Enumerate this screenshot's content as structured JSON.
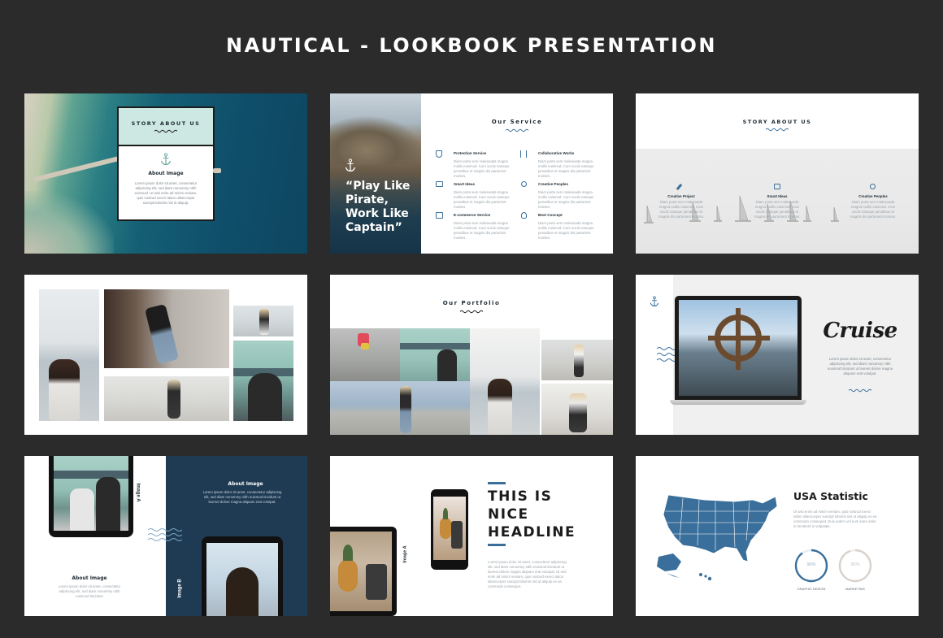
{
  "title": "NAUTICAL - LOOKBOOK PRESENTATION",
  "colors": {
    "background": "#2b2b2b",
    "navy": "#1f3b53",
    "accent_blue": "#3a6f9b",
    "mint": "#cde8e2"
  },
  "slide1": {
    "header": "STORY ABOUT US",
    "subheading": "About Image",
    "body": "Lorem ipsum dolor sit amet, consectetur adipiscing elit, sed diam nonummy nibh euismod. Ut wisi enim ad minim veniam, quis nostrud exerci tation ullamcorper suscipit lobortis nisl ut aliquip."
  },
  "slide2": {
    "quote": "“Play Like Pirate, Work Like Captain”",
    "header": "Our Service",
    "services": [
      {
        "title": "Protection Service",
        "icon": "shield-icon"
      },
      {
        "title": "Collaborative Works",
        "icon": "sliders-icon"
      },
      {
        "title": "Smart Ideas",
        "icon": "chat-icon"
      },
      {
        "title": "Creative Peoples",
        "icon": "user-icon"
      },
      {
        "title": "E-commerce Service",
        "icon": "shop-icon"
      },
      {
        "title": "Best Concept",
        "icon": "bulb-icon"
      }
    ],
    "service_body": "Diam porta sem malesuada magna mollis euismod. Cum sociis natoque penatibus et magnis dis parturient montes."
  },
  "slide3": {
    "header": "STORY ABOUT US",
    "items": [
      {
        "title": "Creative Project",
        "icon": "pencil-icon"
      },
      {
        "title": "Smart Ideas",
        "icon": "chat-icon"
      },
      {
        "title": "Creative Peoples",
        "icon": "user-icon"
      }
    ],
    "item_body": "Diam porta sem malesuada magna mollis euismod. Cum sociis natoque penatibus et magnis dis parturient montes."
  },
  "slide5": {
    "header": "Our Portfolio"
  },
  "slide6": {
    "heading": "Cruise",
    "body": "Lorem ipsum dolor sit amet, consectetur adipiscing elit, sed diam nonummy nibh euismod tincidunt ut laoreet dolore magna aliquam erat volutpat."
  },
  "slide7": {
    "right_heading": "About Image",
    "right_body": "Lorem ipsum dolor sit amet, consectetur adipiscing elit, sed diam nonummy nibh euismod tincidunt ut laoreet dolore magna aliquam erat volutpat.",
    "left_heading": "About Image",
    "left_body": "Lorem ipsum dolor sit amet, consectetur adipiscing elit, sed diam nonummy nibh euismod tincidunt",
    "label_a": "Image A",
    "label_b": "Image B"
  },
  "slide8": {
    "headline": "THIS IS\nNICE\nHEADLINE",
    "label_a": "Image A",
    "body": "Lorem ipsum dolor sit amet, consectetur adipiscing elit, sed diam nonummy nibh euismod tincidunt ut laoreet dolore magna aliquam erat volutpat. Ut wisi enim ad minim veniam, quis nostrud exerci tation ullamcorper suscipit lobortis nisl ut aliquip ex ea commodo consequat."
  },
  "slide9": {
    "heading": "USA Statistic",
    "body": "Ut wisi enim ad minim veniam, quis nostrud exerci tation ullamcorper suscipit lobortis nisl ut aliquip ex ea commodo consequat. Duis autem vel eum iriure dolor in hendrerit in vulputate.",
    "stats": [
      {
        "label": "GRAPHIC DESIGN",
        "value": "90%",
        "fraction": 0.9,
        "color": "#3a6f9b"
      },
      {
        "label": "MARKETING",
        "value": "95%",
        "fraction": 0.95,
        "color": "#d8d2cc"
      }
    ]
  }
}
